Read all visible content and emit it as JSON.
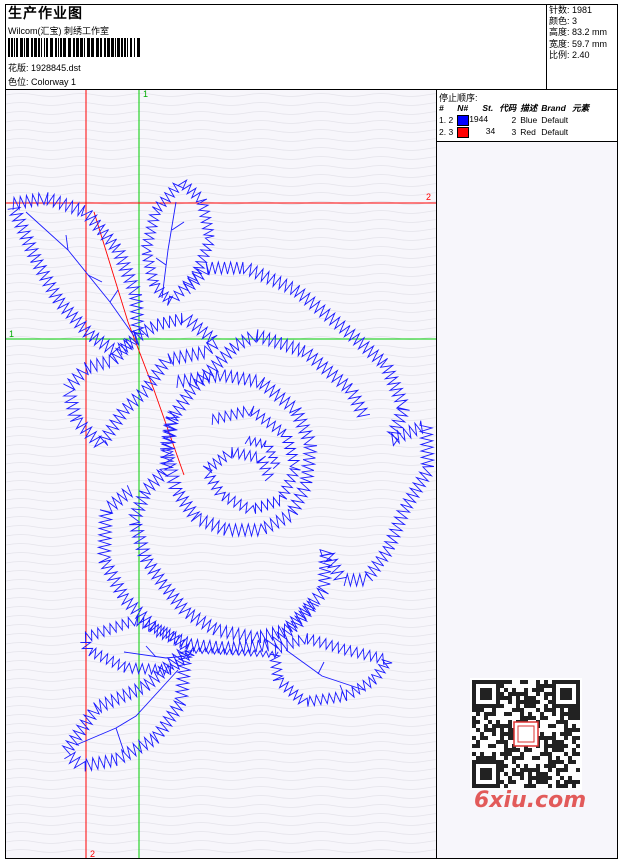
{
  "header": {
    "title": "生产作业图",
    "company": "Wilcom(汇宝) 刺绣工作室",
    "design_label": "花版:",
    "design_file": "1928845.dst",
    "colorway_label": "色位:",
    "colorway_name": "Colorway 1"
  },
  "stats": {
    "stitches_label": "针数:",
    "stitches": "1981",
    "colors_label": "颜色:",
    "colors": "3",
    "height_label": "高度:",
    "height": "83.2 mm",
    "width_label": "宽度:",
    "width": "59.7 mm",
    "scale_label": "比例:",
    "scale": "2.40"
  },
  "color_sequence": {
    "title": "停止顺序:",
    "headers": [
      "#",
      "N#",
      "St.",
      "代码",
      "描述",
      "Brand",
      "元素"
    ],
    "rows": [
      {
        "index": "1.",
        "needle": "2",
        "stitches": "1944",
        "code": "2",
        "desc": "Blue",
        "brand": "Default",
        "color": "#0000ff"
      },
      {
        "index": "2.",
        "needle": "3",
        "stitches": "34",
        "code": "3",
        "desc": "Red",
        "brand": "Default",
        "color": "#ff0000"
      }
    ]
  },
  "guides": {
    "v1_label": "1",
    "v2_label": "2",
    "h1_label": "1",
    "h2_label": "2",
    "guide_red": "#ff0000",
    "guide_green": "#00cc00"
  },
  "colors": {
    "stitch_blue": "#1a1aff",
    "background": "#f7f6fb"
  },
  "watermark": {
    "text": "6xiu.com"
  }
}
